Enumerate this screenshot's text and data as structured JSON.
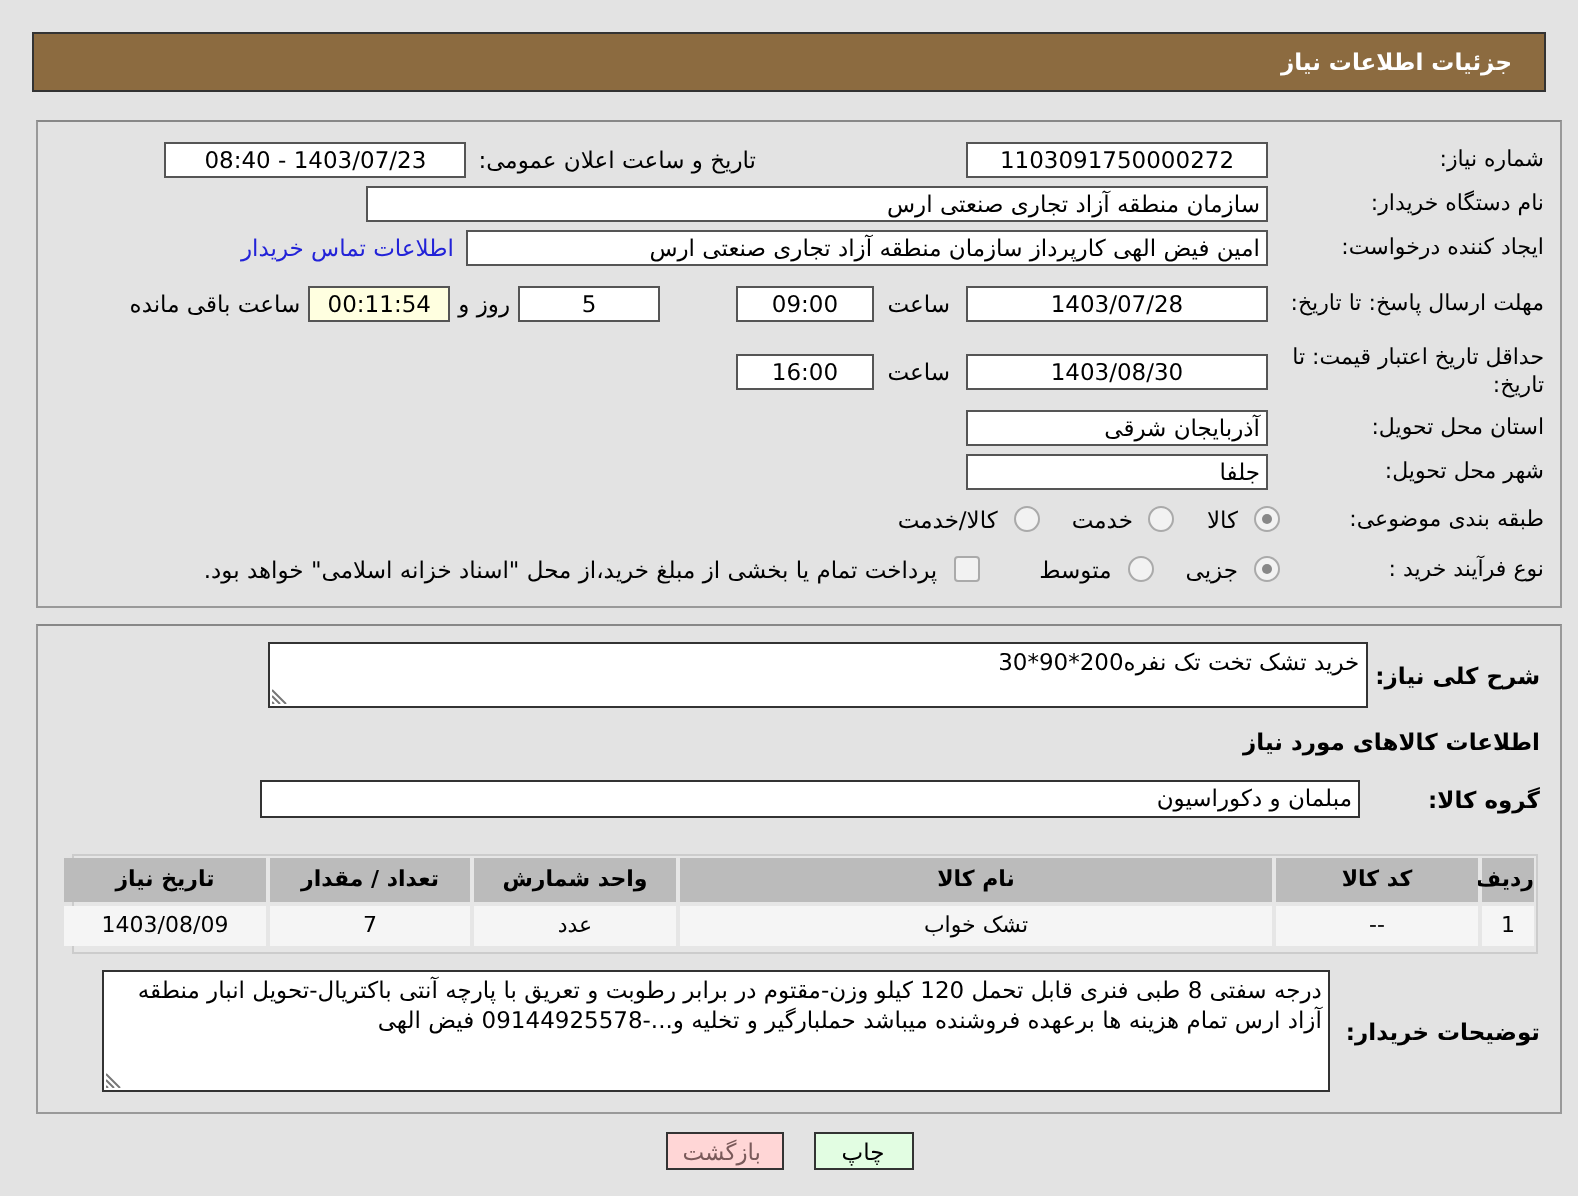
{
  "header": {
    "title": "جزئیات اطلاعات نیاز"
  },
  "details": [
    {
      "label": "شماره نیاز:",
      "items": [
        {
          "kind": "field",
          "value": "1103091750000272"
        },
        {
          "kind": "text",
          "value": "تاریخ و ساعت اعلان عمومی:"
        },
        {
          "kind": "field",
          "value": "1403/07/23 - 08:40"
        }
      ]
    },
    {
      "label": "نام دستگاه خریدار:",
      "items": [
        {
          "kind": "field",
          "value": "سازمان منطقه آزاد تجاری صنعتی ارس"
        }
      ]
    },
    {
      "label": "ایجاد کننده درخواست:",
      "items": [
        {
          "kind": "field",
          "value": "امین فیض الهی کارپرداز سازمان منطقه آزاد تجاری صنعتی ارس"
        },
        {
          "kind": "link",
          "value": "اطلاعات تماس خریدار"
        }
      ]
    },
    {
      "label": "مهلت ارسال پاسخ: تا تاریخ:",
      "items": [
        {
          "kind": "field",
          "value": "1403/07/28"
        },
        {
          "kind": "text",
          "value": "ساعت"
        },
        {
          "kind": "field",
          "value": "09:00"
        },
        {
          "kind": "field",
          "value": "5"
        },
        {
          "kind": "text",
          "value": "روز و"
        },
        {
          "kind": "timer",
          "value": "00:11:54"
        },
        {
          "kind": "text",
          "value": "ساعت باقی مانده"
        }
      ]
    },
    {
      "label": "حداقل تاریخ اعتبار قیمت: تا تاریخ:",
      "items": [
        {
          "kind": "field",
          "value": "1403/08/30"
        },
        {
          "kind": "text",
          "value": "ساعت"
        },
        {
          "kind": "field",
          "value": "16:00"
        }
      ]
    },
    {
      "label": "استان محل تحویل:",
      "items": [
        {
          "kind": "field",
          "value": "آذربایجان شرقی"
        }
      ]
    },
    {
      "label": "شهر محل تحویل:",
      "items": [
        {
          "kind": "field",
          "value": "جلفا"
        }
      ]
    },
    {
      "label": "طبقه بندی موضوعی:",
      "items": [
        {
          "kind": "radio",
          "value": "کالا",
          "selected": true
        },
        {
          "kind": "radio",
          "value": "خدمت",
          "selected": false
        },
        {
          "kind": "radio",
          "value": "کالا/خدمت",
          "selected": false
        }
      ]
    },
    {
      "label": "نوع فرآیند خرید :",
      "items": [
        {
          "kind": "radio",
          "value": "جزیی",
          "selected": true
        },
        {
          "kind": "radio",
          "value": "متوسط",
          "selected": false
        },
        {
          "kind": "checkbox",
          "value": "پرداخت تمام یا بخشی از مبلغ خرید،از محل \"اسناد خزانه اسلامی\" خواهد بود.",
          "checked": false
        }
      ]
    }
  ],
  "need_description": {
    "label": "شرح کلی نیاز:",
    "value": "خرید تشک تخت تک نفره200*90*30"
  },
  "items_heading": "اطلاعات کالاهای مورد نیاز",
  "goods_group": {
    "label": "گروه کالا:",
    "value": "مبلمان و دکوراسیون"
  },
  "table": {
    "columns": [
      "ردیف",
      "کد کالا",
      "نام کالا",
      "واحد شمارش",
      "تعداد / مقدار",
      "تاریخ نیاز"
    ],
    "rows": [
      [
        "1",
        "--",
        "تشک خواب",
        "عدد",
        "7",
        "1403/08/09"
      ]
    ]
  },
  "buyer_notes": {
    "label": "توضیحات خریدار:",
    "value": "درجه سفتی 8 طبی فنری قابل تحمل 120 کیلو وزن-مقتوم در برابر رطوبت و تعریق با پارچه آنتی باکتریال-تحویل انبار منطقه آزاد ارس تمام هزینه ها برعهده فروشنده میباشد حملبارگیر و تخلیه و...-09144925578 فیض الهی"
  },
  "buttons": [
    {
      "kind": "print",
      "label": "چاپ"
    },
    {
      "kind": "back",
      "label": "بازگشت"
    }
  ]
}
